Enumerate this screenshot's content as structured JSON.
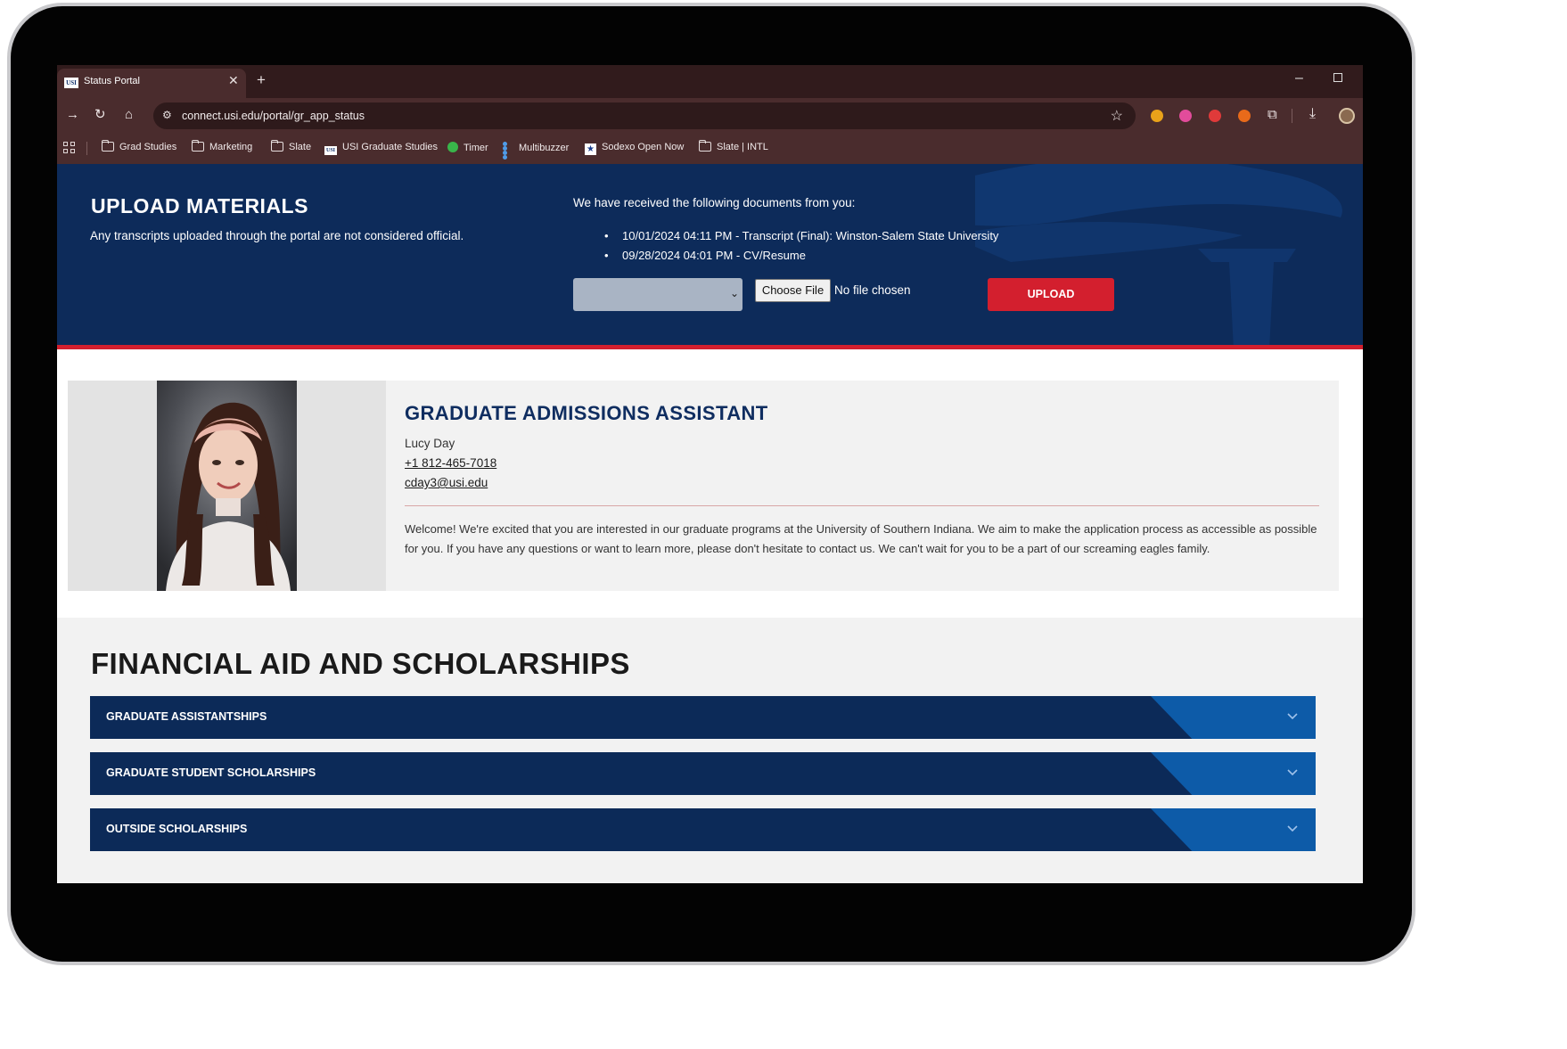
{
  "browser": {
    "tab_title": "Status Portal",
    "tab_favicon": "USI",
    "url": "connect.usi.edu/portal/gr_app_status",
    "bookmarks": [
      {
        "label": "Grad Studies",
        "icon": "folder-icon"
      },
      {
        "label": "Marketing",
        "icon": "folder-icon"
      },
      {
        "label": "Slate",
        "icon": "folder-icon"
      },
      {
        "label": "USI Graduate Studies",
        "icon": "usi-icon"
      },
      {
        "label": "Timer",
        "icon": "timer-icon"
      },
      {
        "label": "Multibuzzer",
        "icon": "multibuzzer-icon"
      },
      {
        "label": "Sodexo Open Now",
        "icon": "sodexo-icon"
      },
      {
        "label": "Slate | INTL",
        "icon": "folder-icon"
      }
    ]
  },
  "upload": {
    "title": "UPLOAD MATERIALS",
    "note": "Any transcripts uploaded through the portal are not considered official.",
    "received_heading": "We have received the following documents from you:",
    "documents": [
      "10/01/2024 04:11 PM - Transcript (Final): Winston-Salem State University",
      "09/28/2024 04:01 PM - CV/Resume"
    ],
    "choose_file_label": "Choose File",
    "no_file_text": "No file chosen",
    "upload_button": "UPLOAD"
  },
  "contact": {
    "title": "GRADUATE ADMISSIONS ASSISTANT",
    "name": "Lucy Day",
    "phone": "+1 812-465-7018",
    "email": "cday3@usi.edu",
    "welcome": "Welcome! We're excited that you are interested in our graduate programs at the University of Southern Indiana. We aim to make the application process as accessible as possible for you. If you have any questions or want to learn more, please don't hesitate to contact us. We can't wait for you to be a part of our screaming eagles family."
  },
  "financial_aid": {
    "title": "FINANCIAL AID AND SCHOLARSHIPS",
    "items": [
      "GRADUATE ASSISTANTSHIPS",
      "GRADUATE STUDENT SCHOLARSHIPS",
      "OUTSIDE SCHOLARSHIPS"
    ]
  },
  "colors": {
    "usi_navy": "#0d2b5a",
    "usi_red": "#d31f2e",
    "accordion_accent": "#0d5ba8",
    "browser_frame": "#4a2c2d"
  }
}
